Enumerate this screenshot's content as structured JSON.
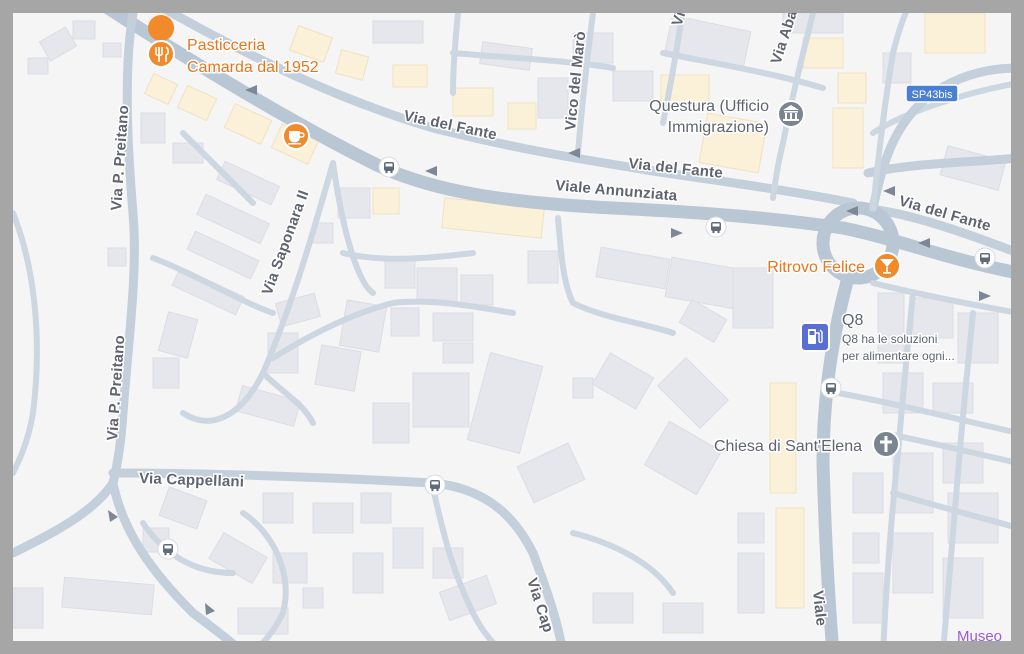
{
  "roads": {
    "via_preitano_top": "Via P. Preitano",
    "via_preitano_bottom": "Via P. Preitano",
    "via_del_fante_1": "Via del Fante",
    "via_del_fante_2": "Via del Fante",
    "via_del_fante_3": "Via del Fante",
    "vico_del_maro": "Vico del Marò",
    "viale_annunziata": "Viale Annunziata",
    "via_saponara": "Via Saponara II",
    "via_cappellani": "Via Cappellani",
    "via_cap": "Via Cap",
    "viale_bottom": "Viale",
    "via_aba": "Via Aba",
    "via_top": "Vi"
  },
  "shield": {
    "label": "SP43bis",
    "color": "#4a7fd4"
  },
  "pois": {
    "pasticceria": {
      "line1": "Pasticceria",
      "line2": "Camarda dal 1952",
      "icon": "restaurant-icon",
      "color": "#f08a2a"
    },
    "cafe": {
      "icon": "cafe-icon",
      "color": "#f08a2a"
    },
    "questura": {
      "line1": "Questura (Ufficio",
      "line2": "Immigrazione)",
      "icon": "government-icon",
      "color": "#7a8591"
    },
    "ritrovo": {
      "label": "Ritrovo Felice",
      "icon": "cocktail-icon",
      "color": "#f08a2a"
    },
    "q8": {
      "name": "Q8",
      "desc1": "Q8 ha le soluzioni",
      "desc2": "per alimentare ogni...",
      "icon": "gas-station-icon",
      "color": "#5a6fd6"
    },
    "chiesa": {
      "label": "Chiesa di Sant'Elena",
      "icon": "church-icon",
      "color": "#7a8591"
    },
    "museo": {
      "label": "Museo",
      "color": "#9a5cd8"
    }
  },
  "bus_stops": [
    "bus-stop-icon"
  ]
}
